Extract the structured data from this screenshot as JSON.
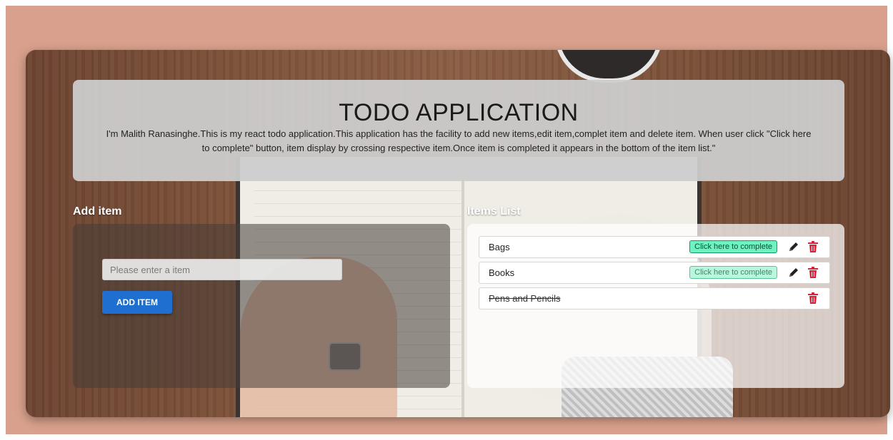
{
  "header": {
    "title": "TODO APPLICATION",
    "description": "I'm Malith Ranasinghe.This is my react todo application.This application has the facility to add new items,edit item,complet item and delete item. When user click \"Click here to complete\" button, item display by crossing respective item.Once item is completed it appears in the bottom of the item list.\""
  },
  "add_section": {
    "heading": "Add item",
    "input_placeholder": "Please enter a item",
    "input_value": "",
    "button_label": "ADD ITEM"
  },
  "list_section": {
    "heading": "Items List",
    "complete_button_label": "Click here to complete",
    "items": [
      {
        "label": "Bags",
        "completed": false
      },
      {
        "label": "Books",
        "completed": false
      },
      {
        "label": "Pens and Pencils",
        "completed": true
      }
    ]
  },
  "icons": {
    "edit": "pencil-icon",
    "delete": "trash-icon"
  },
  "colors": {
    "page_background": "#d9a18d",
    "add_button": "#1e6fd0",
    "complete_button": "#6ff2c2",
    "delete_icon": "#d9233b"
  }
}
